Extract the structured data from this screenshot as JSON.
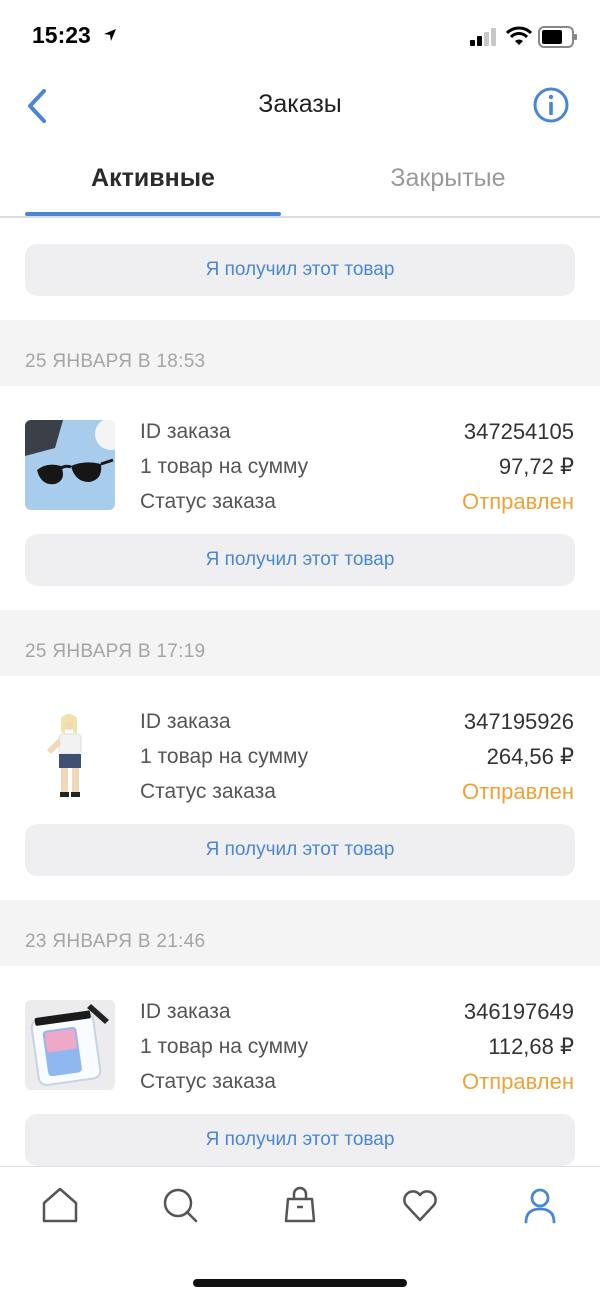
{
  "status_bar": {
    "time": "15:23"
  },
  "nav": {
    "title": "Заказы"
  },
  "tabs": [
    {
      "label": "Активные",
      "active": true
    },
    {
      "label": "Закрытые",
      "active": false
    }
  ],
  "labels": {
    "order_id": "ID заказа",
    "items_sum": "1 товар на сумму",
    "status": "Статус заказа",
    "confirm_button": "Я получил этот товар"
  },
  "orders": [
    {
      "date": "25 ЯНВАРЯ В 18:53",
      "id": "347254105",
      "sum": "97,72 ₽",
      "status": "Отправлен",
      "image": "sunglasses"
    },
    {
      "date": "25 ЯНВАРЯ В 17:19",
      "id": "347195926",
      "sum": "264,56 ₽",
      "status": "Отправлен",
      "image": "woman-outfit"
    },
    {
      "date": "23 ЯНВАРЯ В 21:46",
      "id": "346197649",
      "sum": "112,68 ₽",
      "status": "Отправлен",
      "image": "waterproof-phone-case"
    }
  ],
  "tab_bar": {
    "items": [
      "home-icon",
      "search-icon",
      "bag-icon",
      "heart-icon",
      "profile-icon"
    ],
    "active": "profile-icon"
  },
  "colors": {
    "accent": "#4a86d8",
    "status": "#eda237",
    "button_bg": "#efeff1",
    "section_bg": "#f4f4f5"
  }
}
